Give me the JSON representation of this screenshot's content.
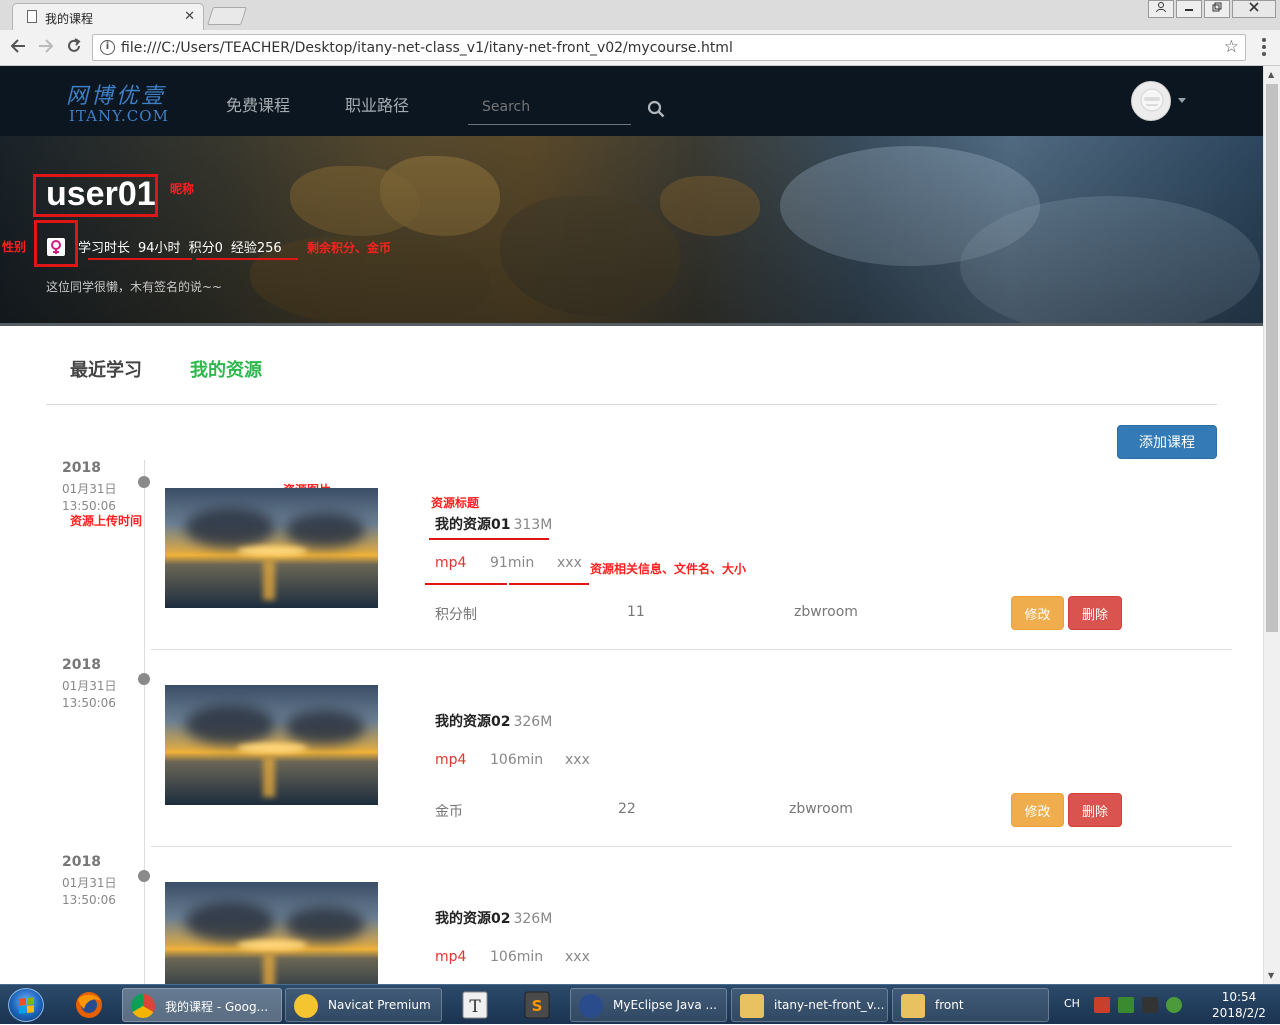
{
  "browser": {
    "tab_title": "我的课程",
    "tab_close": "✕",
    "url": "file:///C:/Users/TEACHER/Desktop/itany-net-class_v1/itany-net-front_v02/mycourse.html"
  },
  "site": {
    "logo_cn": "网博优壹",
    "logo_en": "ITANY.COM",
    "nav": [
      "免费课程",
      "职业路径"
    ],
    "search_placeholder": "Search"
  },
  "profile": {
    "nickname": "user01",
    "study_time": "学习时长",
    "hours": "94小时",
    "points": "积分0",
    "experience": "经验256",
    "signature": "这位同学很懒，木有签名的说~~"
  },
  "annotations": {
    "nickname": "昵称",
    "gender": "性别",
    "remaining": "剩余积分、金币",
    "image": "资源图片",
    "upload_time": "资源上传时间",
    "title": "资源标题",
    "info": "资源相关信息、文件名、大小"
  },
  "tabs": [
    "最近学习",
    "我的资源"
  ],
  "add_course": "添加课程",
  "records": [
    {
      "year": "2018",
      "date": "01月31日",
      "time": "13:50:06",
      "title": "我的资源01",
      "size": "313M",
      "type": "mp4",
      "duration": "91min",
      "file": "xxx",
      "pay": "积分制",
      "price": "11",
      "owner": "zbwroom",
      "edit": "修改",
      "delete": "删除"
    },
    {
      "year": "2018",
      "date": "01月31日",
      "time": "13:50:06",
      "title": "我的资源02",
      "size": "326M",
      "type": "mp4",
      "duration": "106min",
      "file": "xxx",
      "pay": "金币",
      "price": "22",
      "owner": "zbwroom",
      "edit": "修改",
      "delete": "删除"
    },
    {
      "year": "2018",
      "date": "01月31日",
      "time": "13:50:06",
      "title": "我的资源02",
      "size": "326M",
      "type": "mp4",
      "duration": "106min",
      "file": "xxx",
      "pay": "",
      "price": "",
      "owner": "",
      "edit": "",
      "delete": ""
    }
  ],
  "taskbar": {
    "items": [
      "我的课程 - Goog...",
      "Navicat Premium",
      "MyEclipse Java ...",
      "itany-net-front_v...",
      "front"
    ],
    "lang": "CH",
    "time": "10:54",
    "date": "2018/2/2"
  },
  "colors": {
    "nav_bg": "#0b1621",
    "tab_active": "#2db84d",
    "primary": "#337ab7",
    "warning": "#f0ad4e",
    "danger": "#d9534f",
    "annotation_red": "#e01515"
  }
}
